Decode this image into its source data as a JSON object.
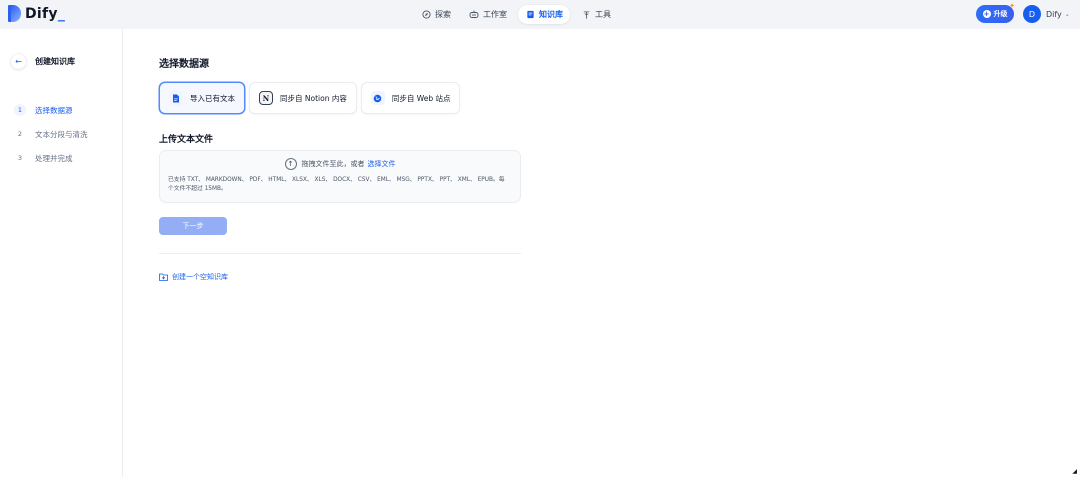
{
  "app": {
    "logo_text": "Dify",
    "brand_color": "#155EEF"
  },
  "topnav": {
    "items": [
      {
        "label": "探索",
        "icon": "compass-icon"
      },
      {
        "label": "工作室",
        "icon": "robot-icon"
      },
      {
        "label": "知识库",
        "icon": "book-icon",
        "active": true
      },
      {
        "label": "工具",
        "icon": "tools-icon"
      }
    ],
    "upgrade_label": "升级",
    "user_initial": "D",
    "user_name": "Dify"
  },
  "sidebar": {
    "title": "创建知识库",
    "steps": [
      {
        "num": "1",
        "label": "选择数据源",
        "active": true
      },
      {
        "num": "2",
        "label": "文本分段与清洗"
      },
      {
        "num": "3",
        "label": "处理并完成"
      }
    ]
  },
  "main": {
    "title": "选择数据源",
    "sources": [
      {
        "label": "导入已有文本",
        "icon": "file-icon",
        "active": true
      },
      {
        "label": "同步自 Notion 内容",
        "icon": "notion-icon"
      },
      {
        "label": "同步自 Web 站点",
        "icon": "globe-icon"
      }
    ],
    "upload_title": "上传文本文件",
    "dropzone": {
      "prompt": "拖拽文件至此，或者",
      "link": "选择文件",
      "hint": "已支持 TXT、 MARKDOWN、 PDF、 HTML、 XLSX、 XLS、 DOCX、 CSV、 EML、 MSG、 PPTX、 PPT、 XML、 EPUB。每个文件不超过 15MB。"
    },
    "next_label": "下一步",
    "empty_kb_label": "创建一个空知识库"
  }
}
